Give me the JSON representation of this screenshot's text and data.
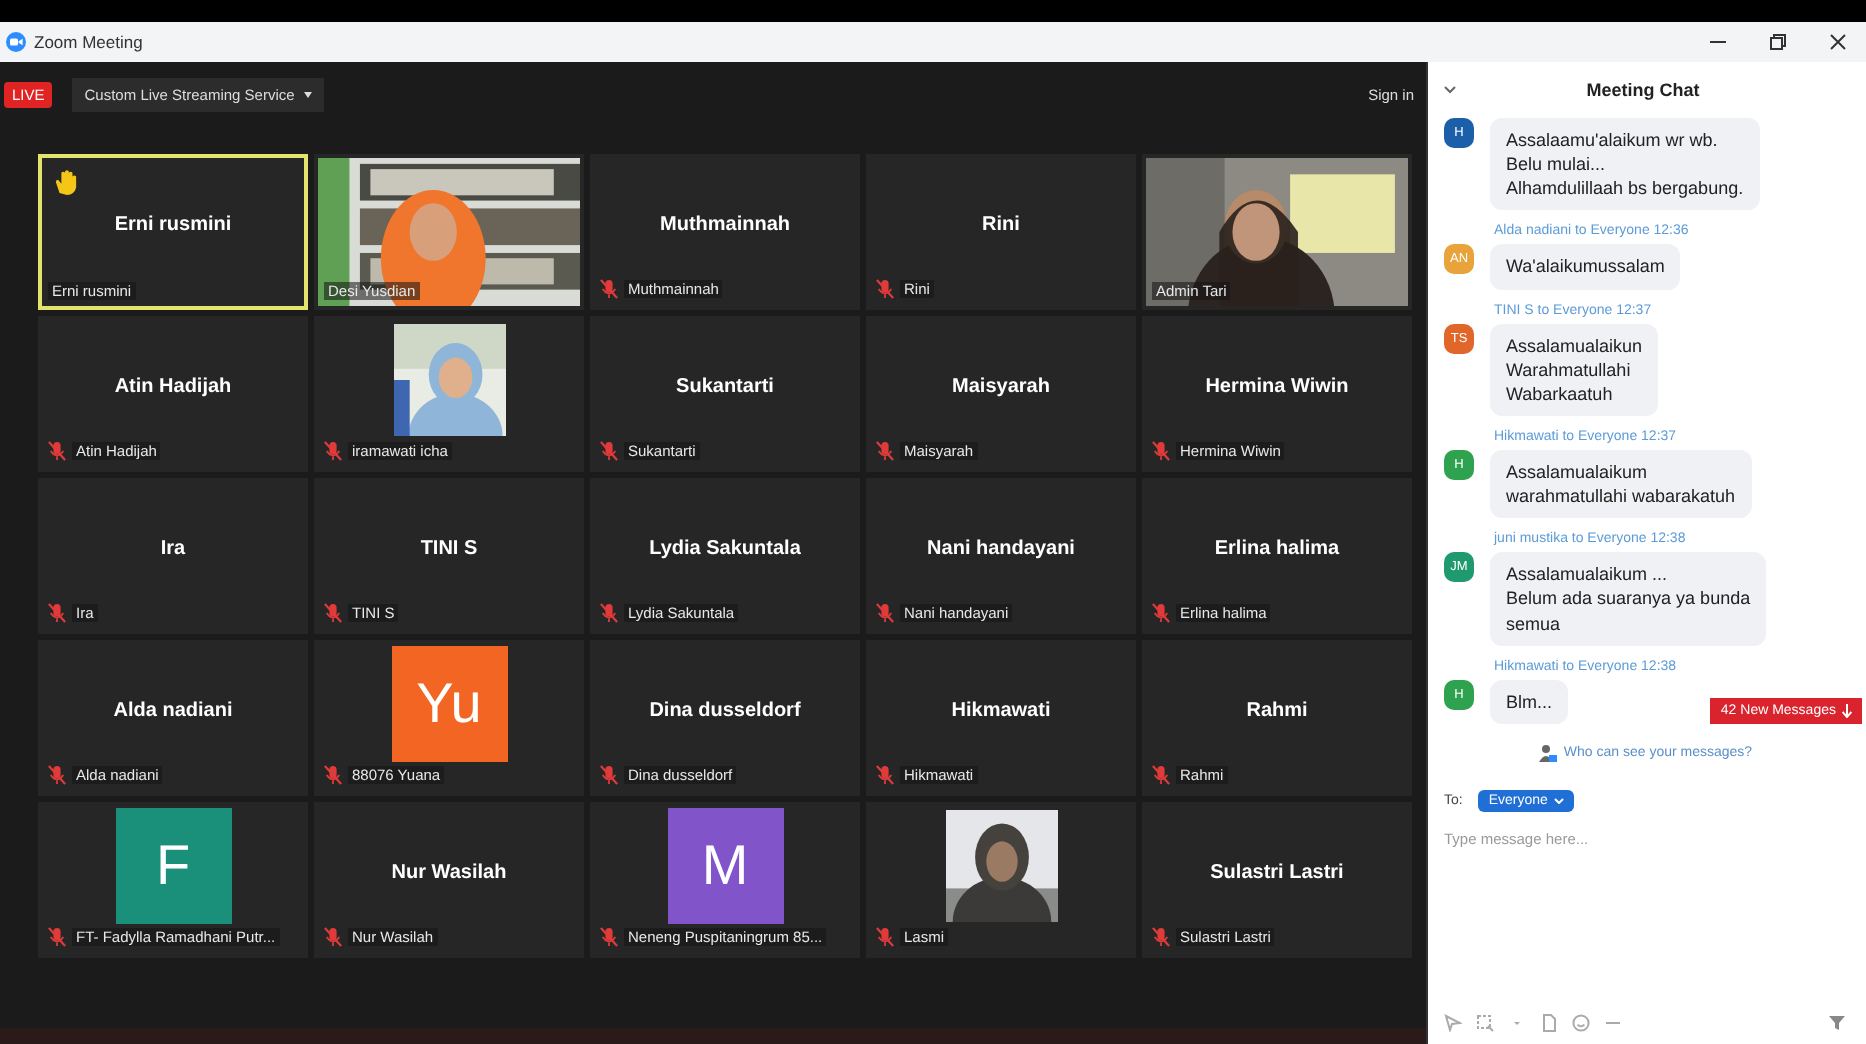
{
  "window": {
    "title": "Zoom Meeting"
  },
  "top_bar": {
    "live_badge": "LIVE",
    "streaming_menu": "Custom Live Streaming Service",
    "sign_in": "Sign in"
  },
  "tiles": [
    {
      "kind": "name",
      "name": "Erni rusmini",
      "label": "Erni rusmini",
      "muted": false,
      "active": true,
      "hand_raised": true
    },
    {
      "kind": "video",
      "label": "Desi Yusdian",
      "muted": false,
      "active": false,
      "hand_raised": false
    },
    {
      "kind": "name",
      "name": "Muthmainnah",
      "label": "Muthmainnah",
      "muted": true,
      "active": false,
      "hand_raised": false
    },
    {
      "kind": "name",
      "name": "Rini",
      "label": "Rini",
      "muted": true,
      "active": false,
      "hand_raised": false
    },
    {
      "kind": "video",
      "label": "Admin Tari",
      "muted": false,
      "active": false,
      "hand_raised": false
    },
    {
      "kind": "name",
      "name": "Atin Hadijah",
      "label": "Atin Hadijah",
      "muted": true,
      "active": false,
      "hand_raised": false
    },
    {
      "label": "iramawati icha",
      "muted": true,
      "active": false,
      "hand_raised": false
    },
    {
      "kind": "name",
      "name": "Sukantarti",
      "label": "Sukantarti",
      "muted": true,
      "active": false,
      "hand_raised": false
    },
    {
      "kind": "name",
      "name": "Maisyarah",
      "label": "Maisyarah",
      "muted": true,
      "active": false,
      "hand_raised": false
    },
    {
      "kind": "name",
      "name": "Hermina Wiwin",
      "label": "Hermina Wiwin",
      "muted": true,
      "active": false,
      "hand_raised": false
    },
    {
      "kind": "name",
      "name": "Ira",
      "label": "Ira",
      "muted": true,
      "active": false,
      "hand_raised": false
    },
    {
      "kind": "name",
      "name": "TINI S",
      "label": "TINI S",
      "muted": true,
      "active": false,
      "hand_raised": false
    },
    {
      "kind": "name",
      "name": "Lydia Sakuntala",
      "label": "Lydia Sakuntala",
      "muted": true,
      "active": false,
      "hand_raised": false
    },
    {
      "kind": "name",
      "name": "Nani handayani",
      "label": "Nani handayani",
      "muted": true,
      "active": false,
      "hand_raised": false
    },
    {
      "kind": "name",
      "name": "Erlina halima",
      "label": "Erlina halima",
      "muted": true,
      "active": false,
      "hand_raised": false
    },
    {
      "kind": "name",
      "name": "Alda nadiani",
      "label": "Alda nadiani",
      "muted": true,
      "active": false,
      "hand_raised": false
    },
    {
      "kind": "avatar",
      "initials": "Yu",
      "color": "#f26522",
      "label": "88076 Yuana",
      "muted": true,
      "active": false,
      "hand_raised": false
    },
    {
      "kind": "name",
      "name": "Dina dusseldorf",
      "label": "Dina dusseldorf",
      "muted": true,
      "active": false,
      "hand_raised": false
    },
    {
      "kind": "name",
      "name": "Hikmawati",
      "label": "Hikmawati",
      "muted": true,
      "active": false,
      "hand_raised": false
    },
    {
      "kind": "name",
      "name": "Rahmi",
      "label": "Rahmi",
      "muted": true,
      "active": false,
      "hand_raised": false
    },
    {
      "kind": "avatar",
      "initials": "F",
      "color": "#1a8f7a",
      "label": "FT- Fadylla Ramadhani Putr...",
      "muted": true,
      "active": false,
      "hand_raised": false
    },
    {
      "kind": "name",
      "name": "Nur Wasilah",
      "label": "Nur Wasilah",
      "muted": true,
      "active": false,
      "hand_raised": false
    },
    {
      "kind": "avatar",
      "initials": "M",
      "color": "#8155c9",
      "label": "Neneng Puspitaningrum 85...",
      "muted": true,
      "active": false,
      "hand_raised": false
    },
    {
      "label": "Lasmi",
      "muted": true,
      "active": false,
      "hand_raised": false
    },
    {
      "kind": "name",
      "name": "Sulastri Lastri",
      "label": "Sulastri Lastri",
      "muted": true,
      "active": false,
      "hand_raised": false
    }
  ],
  "chat": {
    "title": "Meeting Chat",
    "messages": [
      {
        "avatar": "H",
        "color": "#1b5fa8",
        "text": "Assalaamu'alaikum wr wb.\nBelu mulai...\nAlhamdulillaah bs bergabung."
      },
      {
        "sender": "Alda nadiani to Everyone 12:36",
        "avatar": "AN",
        "color": "#e8a33a",
        "text": "Wa'alaikumussalam"
      },
      {
        "sender": "TINI S to Everyone 12:37",
        "avatar": "TS",
        "color": "#e0662a",
        "text": "Assalamualaikun\nWarahmatullahi\nWabarkaatuh"
      },
      {
        "sender": "Hikmawati to Everyone 12:37",
        "avatar": "H",
        "color": "#2fa24f",
        "text": "Assalamualaikum\nwarahmatullahi wabarakatuh"
      },
      {
        "sender": "juni mustika to Everyone 12:38",
        "avatar": "JM",
        "color": "#1f9a6e",
        "text": "Assalamualaikum ...\nBelum ada suaranya ya bunda\nsemua"
      },
      {
        "sender": "Hikmawati to Everyone 12:38",
        "avatar": "H",
        "color": "#2fa24f",
        "text": "Blm..."
      }
    ],
    "new_messages": "42 New Messages",
    "visibility_note": "Who can see your messages?",
    "to_label": "To:",
    "recipient": "Everyone",
    "placeholder": "Type message here..."
  }
}
